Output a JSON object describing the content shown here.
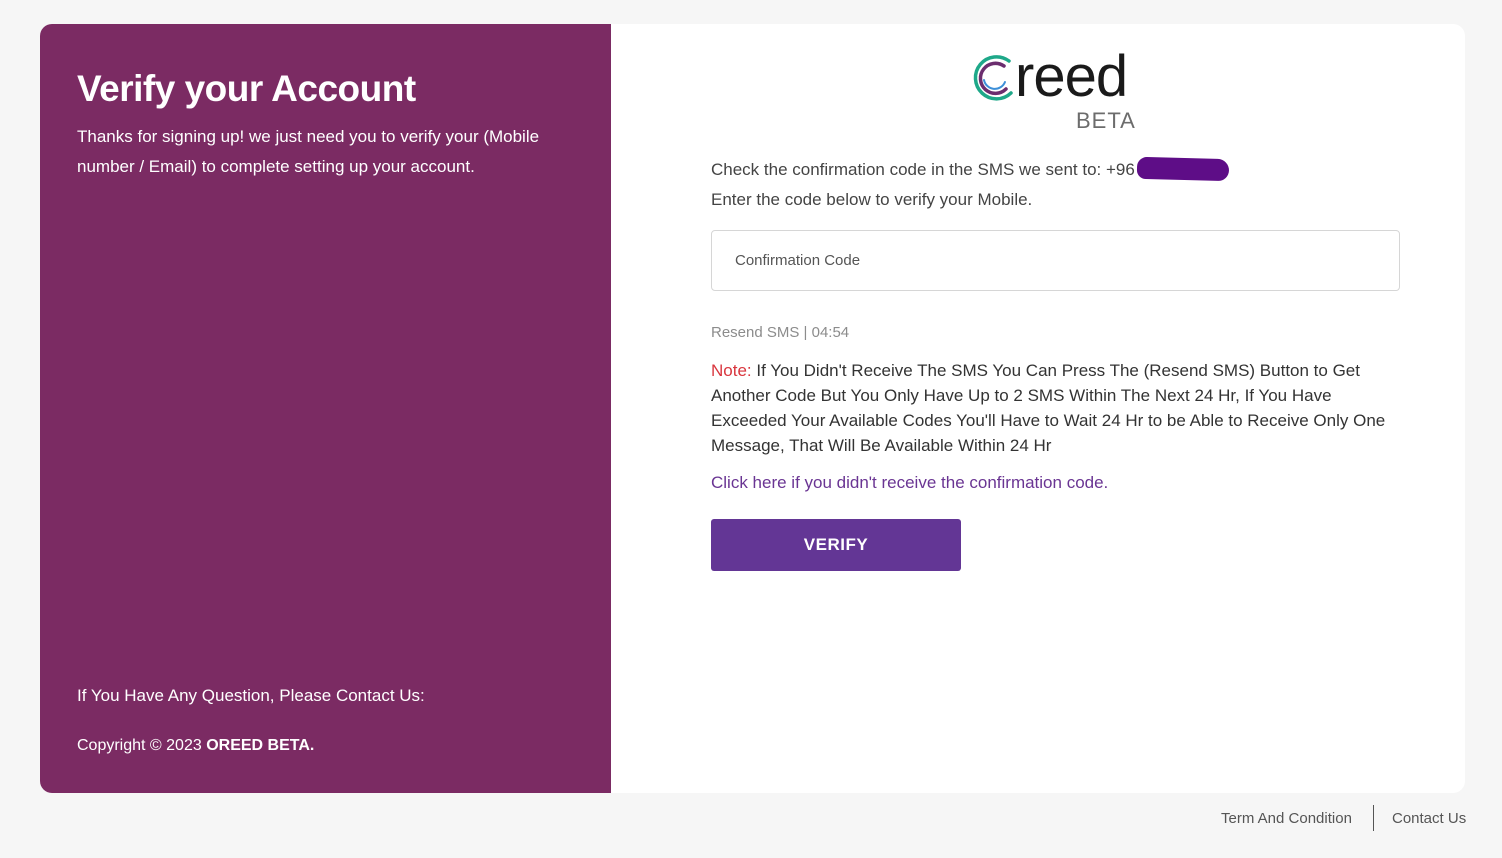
{
  "left_panel": {
    "title": "Verify your Account",
    "description": "Thanks for signing up! we just need you to verify your (Mobile number / Email) to complete setting up your account.",
    "contact_text": "If You Have Any Question, Please Contact Us:",
    "copyright_prefix": "Copyright © 2023 ",
    "copyright_brand": "OREED BETA."
  },
  "logo": {
    "word": "reed",
    "badge": "BETA"
  },
  "verification": {
    "sent_text": "Check the confirmation code in the SMS we sent to: +96",
    "enter_text": "Enter the code below to verify your Mobile.",
    "code_placeholder": "Confirmation Code",
    "code_value": "",
    "resend_text": "Resend SMS | 04:54",
    "note_label": "Note:",
    "note_text": " If You Didn't Receive The SMS You Can Press The (Resend SMS) Button to Get Another Code But You Only Have Up to 2 SMS Within The Next 24 Hr, If You Have Exceeded Your Available Codes You'll Have to Wait 24 Hr to be Able to Receive Only One Message, That Will Be Available Within 24 Hr",
    "no_code_link": "Click here if you didn't receive the confirmation code.",
    "verify_label": "VERIFY"
  },
  "footer": {
    "terms_link": "Term And Condition",
    "contact_link": "Contact Us"
  },
  "colors": {
    "panel_purple": "#7b2b63",
    "button_purple": "#633695",
    "link_purple": "#6a3593",
    "note_red": "#d9363e",
    "redaction": "#5e0d87"
  }
}
